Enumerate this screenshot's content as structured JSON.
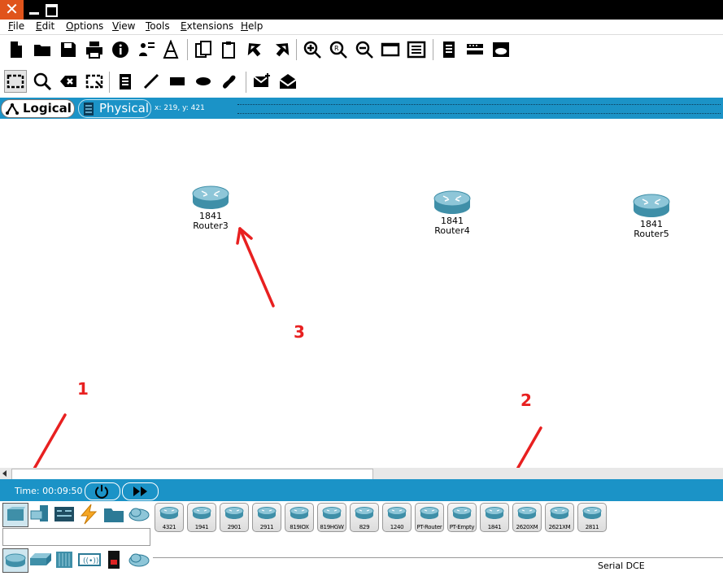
{
  "menu": [
    "File",
    "Edit",
    "Options",
    "View",
    "Tools",
    "Extensions",
    "Help"
  ],
  "tabs": {
    "logical": "Logical",
    "physical": "Physical"
  },
  "coords": "x: 219, y: 421",
  "devices": [
    {
      "model": "1841",
      "name": "Router3"
    },
    {
      "model": "1841",
      "name": "Router4"
    },
    {
      "model": "1841",
      "name": "Router5"
    }
  ],
  "time": "Time: 00:09:50",
  "router_models": [
    "4321",
    "1941",
    "2901",
    "2911",
    "819IOX",
    "819HGW",
    "829",
    "1240",
    "PT-Router",
    "PT-Empty",
    "1841",
    "2620XM",
    "2621XM",
    "2811"
  ],
  "status": "Serial DCE",
  "annotations": [
    "1",
    "2",
    "3"
  ],
  "colors": {
    "accent": "#1b93c7",
    "close": "#e0541b",
    "arrow": "#e82020"
  }
}
